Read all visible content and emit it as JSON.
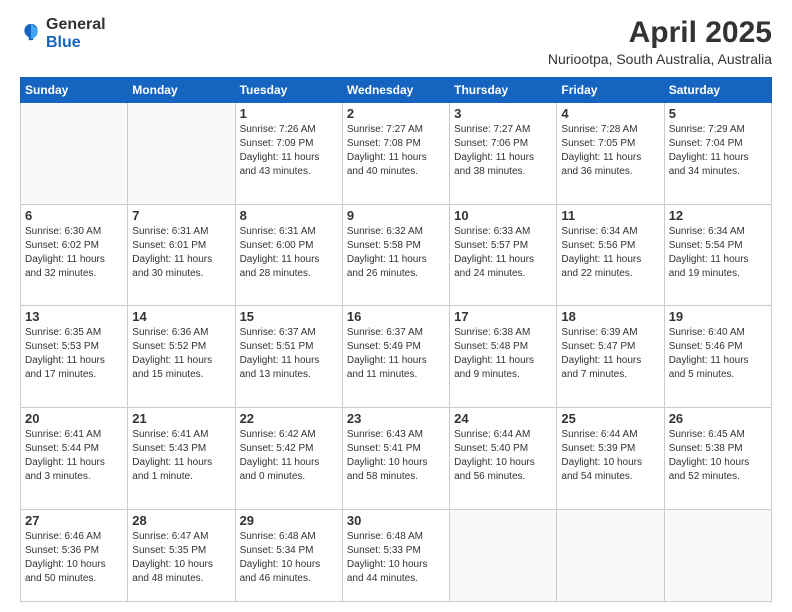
{
  "header": {
    "logo_general": "General",
    "logo_blue": "Blue",
    "title": "April 2025",
    "subtitle": "Nuriootpa, South Australia, Australia"
  },
  "weekdays": [
    "Sunday",
    "Monday",
    "Tuesday",
    "Wednesday",
    "Thursday",
    "Friday",
    "Saturday"
  ],
  "weeks": [
    [
      {
        "day": "",
        "info": ""
      },
      {
        "day": "",
        "info": ""
      },
      {
        "day": "1",
        "info": "Sunrise: 7:26 AM\nSunset: 7:09 PM\nDaylight: 11 hours\nand 43 minutes."
      },
      {
        "day": "2",
        "info": "Sunrise: 7:27 AM\nSunset: 7:08 PM\nDaylight: 11 hours\nand 40 minutes."
      },
      {
        "day": "3",
        "info": "Sunrise: 7:27 AM\nSunset: 7:06 PM\nDaylight: 11 hours\nand 38 minutes."
      },
      {
        "day": "4",
        "info": "Sunrise: 7:28 AM\nSunset: 7:05 PM\nDaylight: 11 hours\nand 36 minutes."
      },
      {
        "day": "5",
        "info": "Sunrise: 7:29 AM\nSunset: 7:04 PM\nDaylight: 11 hours\nand 34 minutes."
      }
    ],
    [
      {
        "day": "6",
        "info": "Sunrise: 6:30 AM\nSunset: 6:02 PM\nDaylight: 11 hours\nand 32 minutes."
      },
      {
        "day": "7",
        "info": "Sunrise: 6:31 AM\nSunset: 6:01 PM\nDaylight: 11 hours\nand 30 minutes."
      },
      {
        "day": "8",
        "info": "Sunrise: 6:31 AM\nSunset: 6:00 PM\nDaylight: 11 hours\nand 28 minutes."
      },
      {
        "day": "9",
        "info": "Sunrise: 6:32 AM\nSunset: 5:58 PM\nDaylight: 11 hours\nand 26 minutes."
      },
      {
        "day": "10",
        "info": "Sunrise: 6:33 AM\nSunset: 5:57 PM\nDaylight: 11 hours\nand 24 minutes."
      },
      {
        "day": "11",
        "info": "Sunrise: 6:34 AM\nSunset: 5:56 PM\nDaylight: 11 hours\nand 22 minutes."
      },
      {
        "day": "12",
        "info": "Sunrise: 6:34 AM\nSunset: 5:54 PM\nDaylight: 11 hours\nand 19 minutes."
      }
    ],
    [
      {
        "day": "13",
        "info": "Sunrise: 6:35 AM\nSunset: 5:53 PM\nDaylight: 11 hours\nand 17 minutes."
      },
      {
        "day": "14",
        "info": "Sunrise: 6:36 AM\nSunset: 5:52 PM\nDaylight: 11 hours\nand 15 minutes."
      },
      {
        "day": "15",
        "info": "Sunrise: 6:37 AM\nSunset: 5:51 PM\nDaylight: 11 hours\nand 13 minutes."
      },
      {
        "day": "16",
        "info": "Sunrise: 6:37 AM\nSunset: 5:49 PM\nDaylight: 11 hours\nand 11 minutes."
      },
      {
        "day": "17",
        "info": "Sunrise: 6:38 AM\nSunset: 5:48 PM\nDaylight: 11 hours\nand 9 minutes."
      },
      {
        "day": "18",
        "info": "Sunrise: 6:39 AM\nSunset: 5:47 PM\nDaylight: 11 hours\nand 7 minutes."
      },
      {
        "day": "19",
        "info": "Sunrise: 6:40 AM\nSunset: 5:46 PM\nDaylight: 11 hours\nand 5 minutes."
      }
    ],
    [
      {
        "day": "20",
        "info": "Sunrise: 6:41 AM\nSunset: 5:44 PM\nDaylight: 11 hours\nand 3 minutes."
      },
      {
        "day": "21",
        "info": "Sunrise: 6:41 AM\nSunset: 5:43 PM\nDaylight: 11 hours\nand 1 minute."
      },
      {
        "day": "22",
        "info": "Sunrise: 6:42 AM\nSunset: 5:42 PM\nDaylight: 11 hours\nand 0 minutes."
      },
      {
        "day": "23",
        "info": "Sunrise: 6:43 AM\nSunset: 5:41 PM\nDaylight: 10 hours\nand 58 minutes."
      },
      {
        "day": "24",
        "info": "Sunrise: 6:44 AM\nSunset: 5:40 PM\nDaylight: 10 hours\nand 56 minutes."
      },
      {
        "day": "25",
        "info": "Sunrise: 6:44 AM\nSunset: 5:39 PM\nDaylight: 10 hours\nand 54 minutes."
      },
      {
        "day": "26",
        "info": "Sunrise: 6:45 AM\nSunset: 5:38 PM\nDaylight: 10 hours\nand 52 minutes."
      }
    ],
    [
      {
        "day": "27",
        "info": "Sunrise: 6:46 AM\nSunset: 5:36 PM\nDaylight: 10 hours\nand 50 minutes."
      },
      {
        "day": "28",
        "info": "Sunrise: 6:47 AM\nSunset: 5:35 PM\nDaylight: 10 hours\nand 48 minutes."
      },
      {
        "day": "29",
        "info": "Sunrise: 6:48 AM\nSunset: 5:34 PM\nDaylight: 10 hours\nand 46 minutes."
      },
      {
        "day": "30",
        "info": "Sunrise: 6:48 AM\nSunset: 5:33 PM\nDaylight: 10 hours\nand 44 minutes."
      },
      {
        "day": "",
        "info": ""
      },
      {
        "day": "",
        "info": ""
      },
      {
        "day": "",
        "info": ""
      }
    ]
  ]
}
